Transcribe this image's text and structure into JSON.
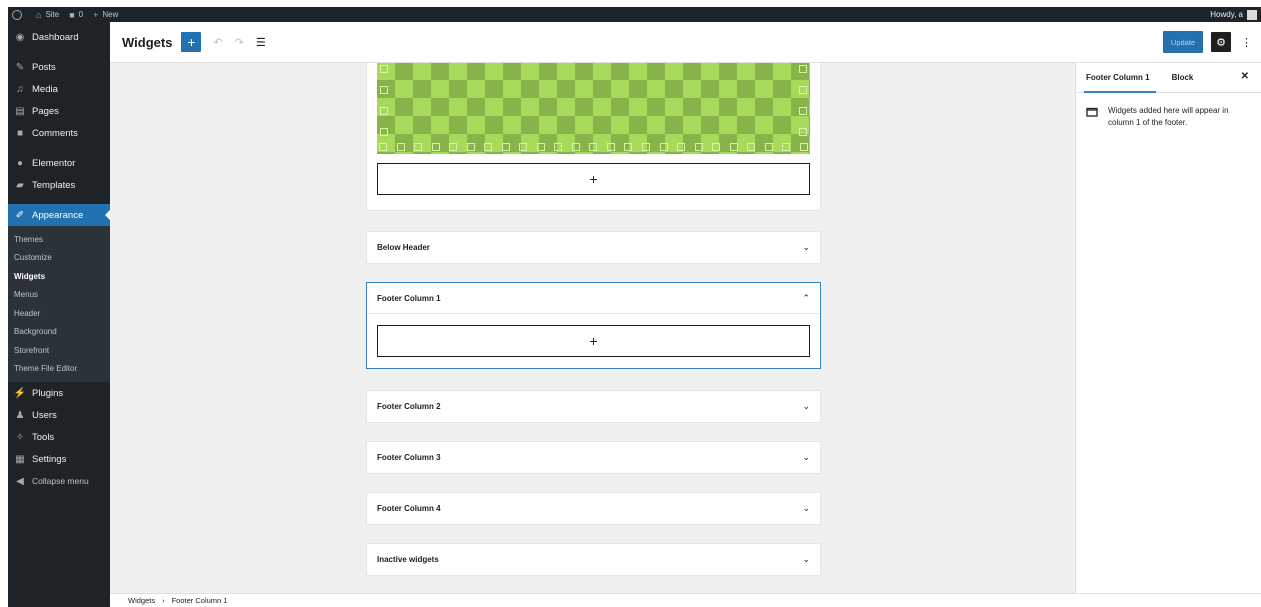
{
  "adminbar": {
    "site": "Site",
    "comments": "0",
    "new": "New",
    "howdy": "Howdy, a"
  },
  "sidebar": {
    "items": [
      {
        "label": "Dashboard",
        "icon": "dashboard-icon"
      },
      {
        "label": "Posts",
        "icon": "pin-icon"
      },
      {
        "label": "Media",
        "icon": "media-icon"
      },
      {
        "label": "Pages",
        "icon": "pages-icon"
      },
      {
        "label": "Comments",
        "icon": "comment-icon"
      },
      {
        "label": "Elementor",
        "icon": "elementor-icon"
      },
      {
        "label": "Templates",
        "icon": "folder-icon"
      },
      {
        "label": "Appearance",
        "icon": "brush-icon"
      },
      {
        "label": "Plugins",
        "icon": "plugin-icon"
      },
      {
        "label": "Users",
        "icon": "user-icon"
      },
      {
        "label": "Tools",
        "icon": "wrench-icon"
      },
      {
        "label": "Settings",
        "icon": "settings-icon"
      },
      {
        "label": "Collapse menu",
        "icon": "collapse-icon"
      }
    ],
    "submenu": [
      "Themes",
      "Customize",
      "Widgets",
      "Menus",
      "Header",
      "Background",
      "Storefront",
      "Theme File Editor"
    ]
  },
  "header": {
    "title": "Widgets",
    "add": "+",
    "update": "Update"
  },
  "canvas": {
    "panels": [
      {
        "title": "Below Header"
      },
      {
        "title": "Footer Column 1"
      },
      {
        "title": "Footer Column 2"
      },
      {
        "title": "Footer Column 3"
      },
      {
        "title": "Footer Column 4"
      },
      {
        "title": "Inactive widgets"
      }
    ],
    "appender": "+"
  },
  "settings": {
    "tab_area": "Footer Column 1",
    "tab_block": "Block",
    "description": "Widgets added here will appear in column 1 of the footer."
  },
  "breadcrumb": {
    "root": "Widgets",
    "current": "Footer Column 1"
  },
  "colors": {
    "accent": "#2271b1",
    "admin_dark": "#1d2327",
    "selection": "#3582c4"
  }
}
